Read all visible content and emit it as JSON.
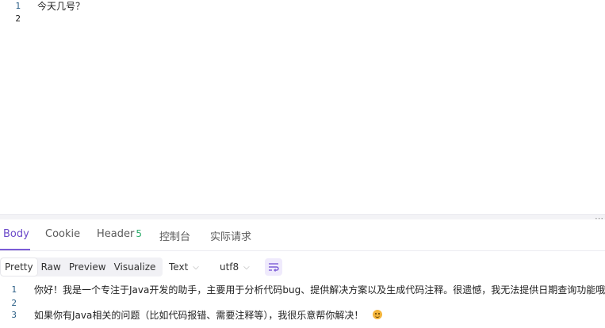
{
  "request_editor": {
    "lines": [
      {
        "number": "1",
        "text": "今天几号？"
      },
      {
        "number": "2",
        "text": ""
      }
    ]
  },
  "splitter": {
    "handle": "⋯"
  },
  "response_tabs": [
    {
      "label": "Body",
      "count": ""
    },
    {
      "label": "Cookie",
      "count": ""
    },
    {
      "label": "Header",
      "count": "5"
    },
    {
      "label": "控制台",
      "count": ""
    },
    {
      "label": "实际请求",
      "count": ""
    }
  ],
  "view_modes": [
    "Pretty",
    "Raw",
    "Preview",
    "Visualize"
  ],
  "format_select": {
    "value": "Text"
  },
  "encoding_select": {
    "value": "utf8"
  },
  "wrap_button": {
    "icon": "wrap-lines-icon"
  },
  "response_body": {
    "lines": [
      {
        "number": "1",
        "text": "你好！我是一个专注于Java开发的助手，主要用于分析代码bug、提供解决方案以及生成代码注释。很遗憾，我无法提供日期查询功能哦"
      },
      {
        "number": "2",
        "text": ""
      },
      {
        "number": "3",
        "text": "如果你有Java相关的问题（比如代码报错、需要注释等），我很乐意帮你解决！"
      }
    ],
    "emoji": "smiling-face-icon"
  },
  "colors": {
    "accent": "#7b5cd6",
    "line_number": "#2b5f86",
    "count_badge": "#2fae6e"
  }
}
